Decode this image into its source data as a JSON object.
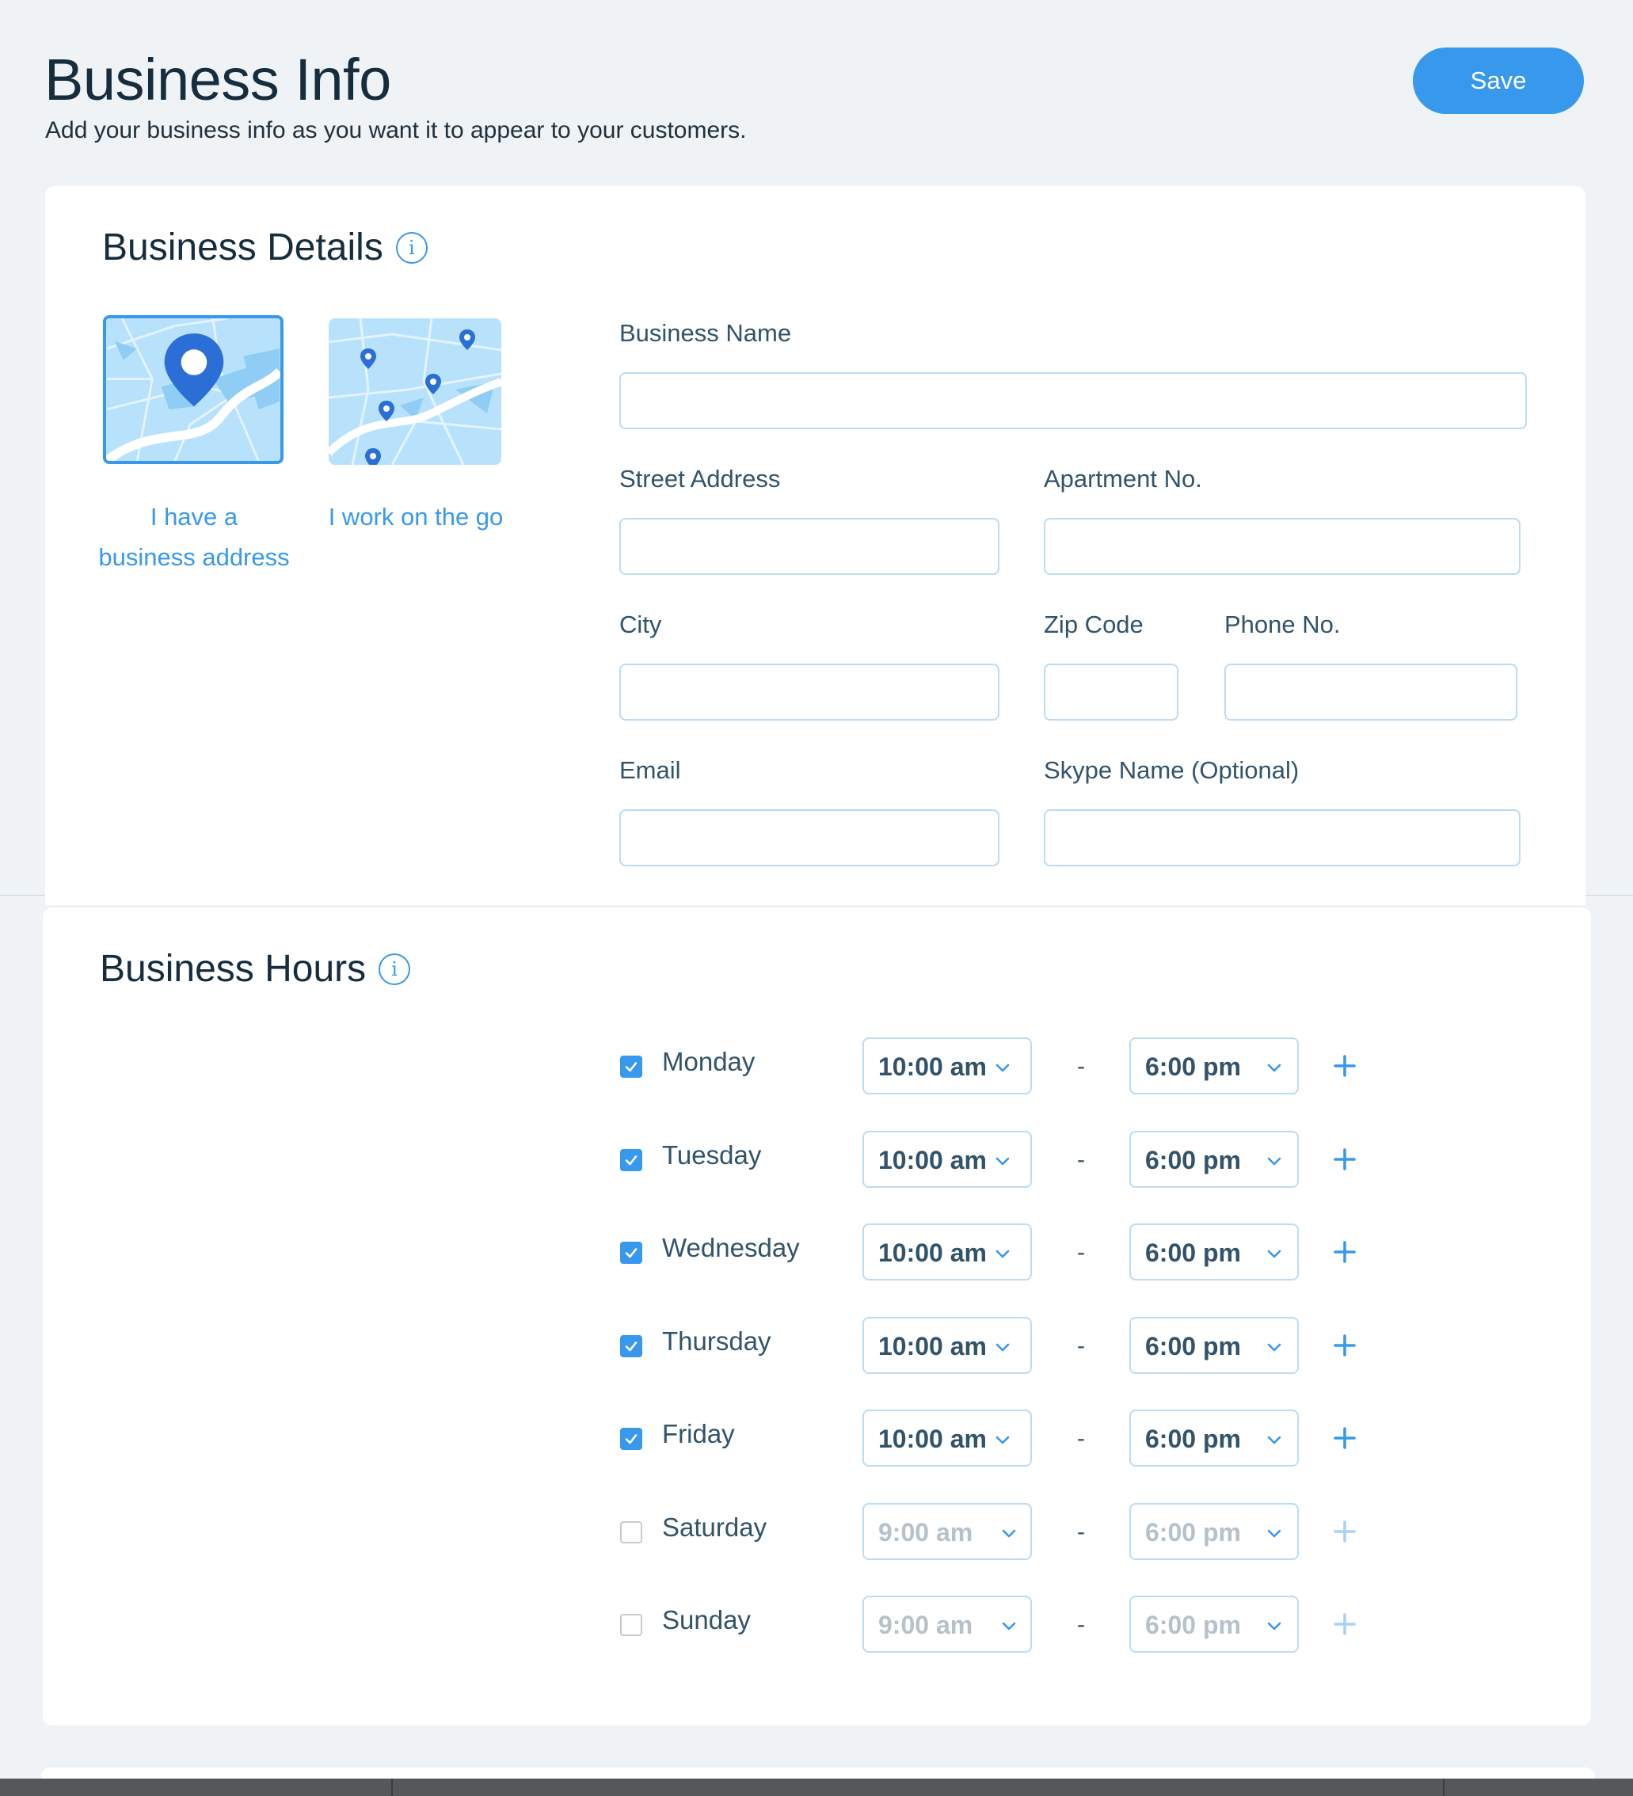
{
  "header": {
    "title": "Business Info",
    "subtitle": "Add your business info as you want it to appear to your customers.",
    "save_label": "Save"
  },
  "business_details": {
    "title": "Business Details",
    "location_options": [
      {
        "label_line1": "I have a",
        "label_line2": "business address",
        "selected": true
      },
      {
        "label_line1": "I work on the go",
        "label_line2": "",
        "selected": false
      }
    ],
    "fields": {
      "business_name": {
        "label": "Business Name",
        "value": ""
      },
      "street_address": {
        "label": "Street Address",
        "value": ""
      },
      "apartment_no": {
        "label": "Apartment No.",
        "value": ""
      },
      "city": {
        "label": "City",
        "value": ""
      },
      "zip_code": {
        "label": "Zip Code",
        "value": ""
      },
      "phone_no": {
        "label": "Phone No.",
        "value": ""
      },
      "email": {
        "label": "Email",
        "value": ""
      },
      "skype_name": {
        "label": "Skype Name (Optional)",
        "value": ""
      }
    }
  },
  "business_hours": {
    "title": "Business Hours",
    "separator": "-",
    "days": [
      {
        "day": "Monday",
        "checked": true,
        "open": "10:00 am",
        "close": "6:00 pm"
      },
      {
        "day": "Tuesday",
        "checked": true,
        "open": "10:00 am",
        "close": "6:00 pm"
      },
      {
        "day": "Wednesday",
        "checked": true,
        "open": "10:00 am",
        "close": "6:00 pm"
      },
      {
        "day": "Thursday",
        "checked": true,
        "open": "10:00 am",
        "close": "6:00 pm"
      },
      {
        "day": "Friday",
        "checked": true,
        "open": "10:00 am",
        "close": "6:00 pm"
      },
      {
        "day": "Saturday",
        "checked": false,
        "open": "9:00 am",
        "close": "6:00 pm"
      },
      {
        "day": "Sunday",
        "checked": false,
        "open": "9:00 am",
        "close": "6:00 pm"
      }
    ]
  },
  "colors": {
    "accent": "#3899ec",
    "background": "#eff3f6",
    "input_border": "#bcdcf3",
    "map_light": "#b8e2fb",
    "map_pin": "#2b6fd6"
  },
  "icons": {
    "info": "info-icon",
    "checkmark": "checkmark-icon",
    "chevron": "chevron-down-icon",
    "plus": "plus-icon",
    "pin": "map-pin-icon"
  }
}
